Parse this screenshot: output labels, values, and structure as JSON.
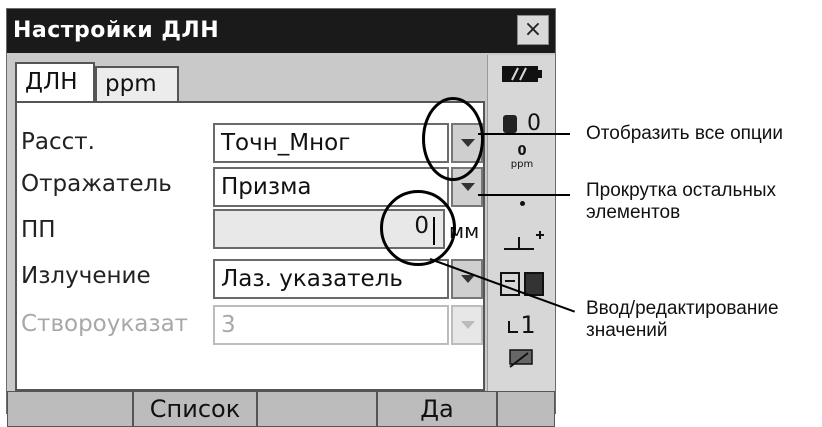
{
  "window": {
    "title": "Настройки ДЛН",
    "close_label": "×",
    "tabs": [
      {
        "label": "ДЛН",
        "active": true
      },
      {
        "label": "ppm",
        "active": false
      }
    ]
  },
  "form": {
    "distance": {
      "label": "Расст.",
      "value": "Точн_Мног"
    },
    "reflector": {
      "label": "Отражатель",
      "value": "Призма"
    },
    "pp": {
      "label": "ПП",
      "value": "0",
      "unit": "мм"
    },
    "emission": {
      "label": "Излучение",
      "value": "Лаз. указатель"
    },
    "guide": {
      "label": "Створоуказат",
      "value": "3",
      "disabled": true
    }
  },
  "status": {
    "battery_icon": "battery-icon",
    "target_value": "0",
    "ppm_value": "0",
    "ppm_label": "ppm",
    "mode_value": "1"
  },
  "softkeys": {
    "list_label": "Список",
    "ok_label": "Да"
  },
  "callouts": {
    "show_options": "Отобразить все опции",
    "scroll_line1": "Прокрутка остальных",
    "scroll_line2": "элементов",
    "edit_line1": "Ввод/редактирование",
    "edit_line2": "значений"
  },
  "colors": {
    "titlebar": "#1a1a1a",
    "window_bg": "#c9c9c9",
    "softkey_bg": "#bcbcbc"
  }
}
